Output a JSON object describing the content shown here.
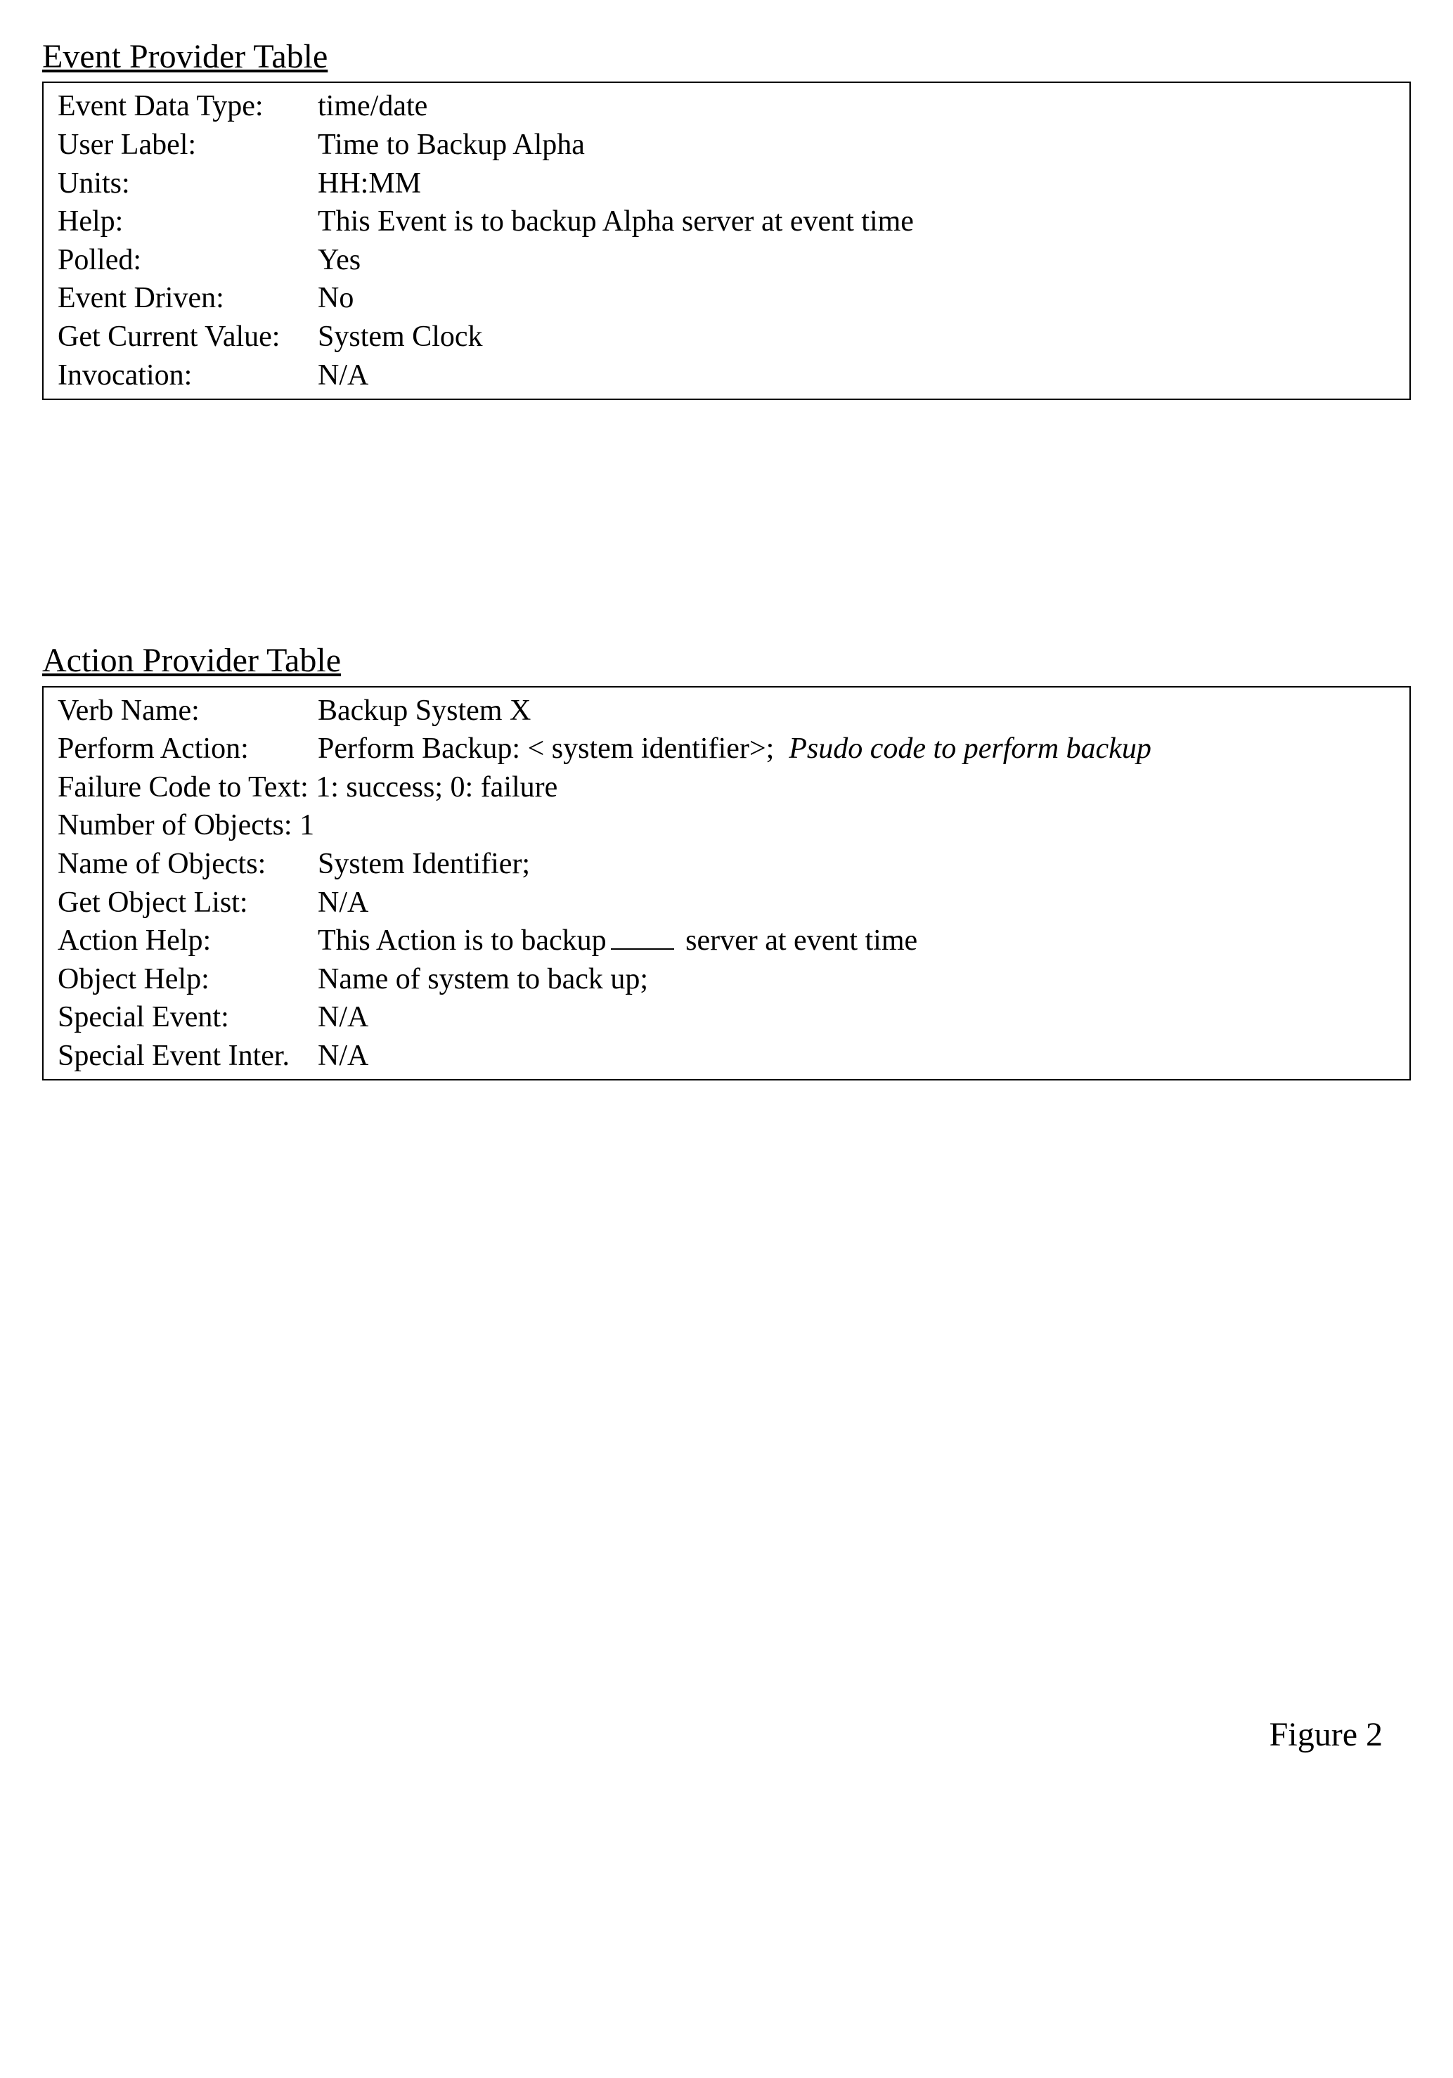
{
  "eventProvider": {
    "title": "Event Provider Table",
    "rows": {
      "eventDataType": {
        "label": "Event Data Type:",
        "value": "time/date"
      },
      "userLabel": {
        "label": "User Label:",
        "value": "Time to Backup Alpha"
      },
      "units": {
        "label": "Units:",
        "value": "HH:MM"
      },
      "help": {
        "label": "Help:",
        "value": "This Event is to backup Alpha server at event time"
      },
      "polled": {
        "label": "Polled:",
        "value": "Yes"
      },
      "eventDriven": {
        "label": "Event Driven:",
        "value": "No"
      },
      "getCurrentValue": {
        "label": "Get Current Value:",
        "value": "System Clock"
      },
      "invocation": {
        "label": "Invocation:",
        "value": "N/A"
      }
    }
  },
  "actionProvider": {
    "title": "Action Provider Table",
    "rows": {
      "verbName": {
        "label": "Verb Name:",
        "value": "Backup System X"
      },
      "performAction": {
        "label": "Perform Action:",
        "value": "Perform Backup: < system identifier>;",
        "italic": "Psudo code to perform backup"
      },
      "failureCode": {
        "full": "Failure Code to Text: 1: success; 0: failure"
      },
      "numObjects": {
        "full": "Number of Objects: 1"
      },
      "nameObjects": {
        "label": "Name of Objects:",
        "value": "System Identifier;"
      },
      "getObjectList": {
        "label": "Get Object List:",
        "value": "N/A"
      },
      "actionHelp": {
        "label": "Action Help:",
        "pre": "This Action is to backup",
        "post": " server at event time"
      },
      "objectHelp": {
        "label": "Object Help:",
        "value": "Name of system to back up;"
      },
      "specialEvent": {
        "label": "Special Event:",
        "value": "N/A"
      },
      "specialEventInter": {
        "label": "Special Event Inter.",
        "value": "N/A"
      }
    }
  },
  "figureLabel": "Figure 2"
}
